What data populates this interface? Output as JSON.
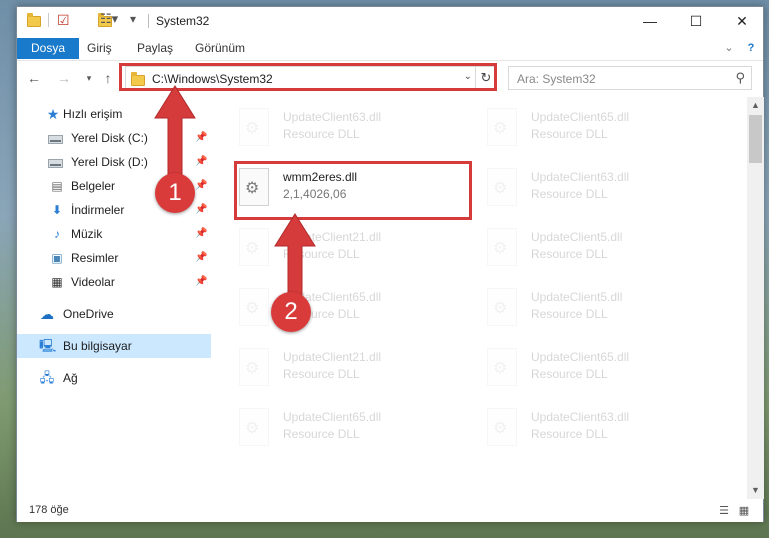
{
  "window": {
    "title": "System32",
    "controls": {
      "minimize": "—",
      "maximize": "☐",
      "close": "✕"
    }
  },
  "ribbon": {
    "tabs": [
      {
        "label": "Dosya",
        "active": true
      },
      {
        "label": "Giriş",
        "active": false
      },
      {
        "label": "Paylaş",
        "active": false
      },
      {
        "label": "Görünüm",
        "active": false
      }
    ]
  },
  "address": {
    "path": "C:\\Windows\\System32",
    "search_placeholder": "Ara: System32"
  },
  "sidebar": {
    "quick_access": "Hızlı erişim",
    "items": [
      {
        "label": "Yerel Disk (C:)",
        "icon": "disk-icon",
        "pinned": true
      },
      {
        "label": "Yerel Disk (D:)",
        "icon": "disk-icon",
        "pinned": true
      },
      {
        "label": "Belgeler",
        "icon": "documents-icon",
        "pinned": true
      },
      {
        "label": "İndirmeler",
        "icon": "download-icon",
        "pinned": true
      },
      {
        "label": "Müzik",
        "icon": "music-icon",
        "pinned": true
      },
      {
        "label": "Resimler",
        "icon": "pictures-icon",
        "pinned": true
      },
      {
        "label": "Videolar",
        "icon": "video-icon",
        "pinned": true
      }
    ],
    "onedrive": "OneDrive",
    "this_pc": "Bu bilgisayar",
    "network": "Ağ"
  },
  "files": {
    "left_column": [
      {
        "name": "UpdateClient63.dll",
        "desc": "Resource DLL"
      },
      {
        "name": "wmm2eres.dll",
        "desc": "2,1,4026,06"
      },
      {
        "name": "UpdateClient21.dll",
        "desc": "Resource DLL"
      },
      {
        "name": "UpdateClient65.dll",
        "desc": "Resource DLL"
      },
      {
        "name": "UpdateClient21.dll",
        "desc": "Resource DLL"
      },
      {
        "name": "UpdateClient65.dll",
        "desc": "Resource DLL"
      }
    ],
    "right_column": [
      {
        "name": "UpdateClient65.dll",
        "desc": "Resource DLL"
      },
      {
        "name": "UpdateClient63.dll",
        "desc": "Resource DLL"
      },
      {
        "name": "UpdateClient5.dll",
        "desc": "Resource DLL"
      },
      {
        "name": "UpdateClient5.dll",
        "desc": "Resource DLL"
      },
      {
        "name": "UpdateClient65.dll",
        "desc": "Resource DLL"
      },
      {
        "name": "UpdateClient63.dll",
        "desc": "Resource DLL"
      }
    ]
  },
  "status": {
    "count": "178 öğe"
  },
  "annotations": {
    "step1": "1",
    "step2": "2",
    "color": "#d63b3b"
  }
}
